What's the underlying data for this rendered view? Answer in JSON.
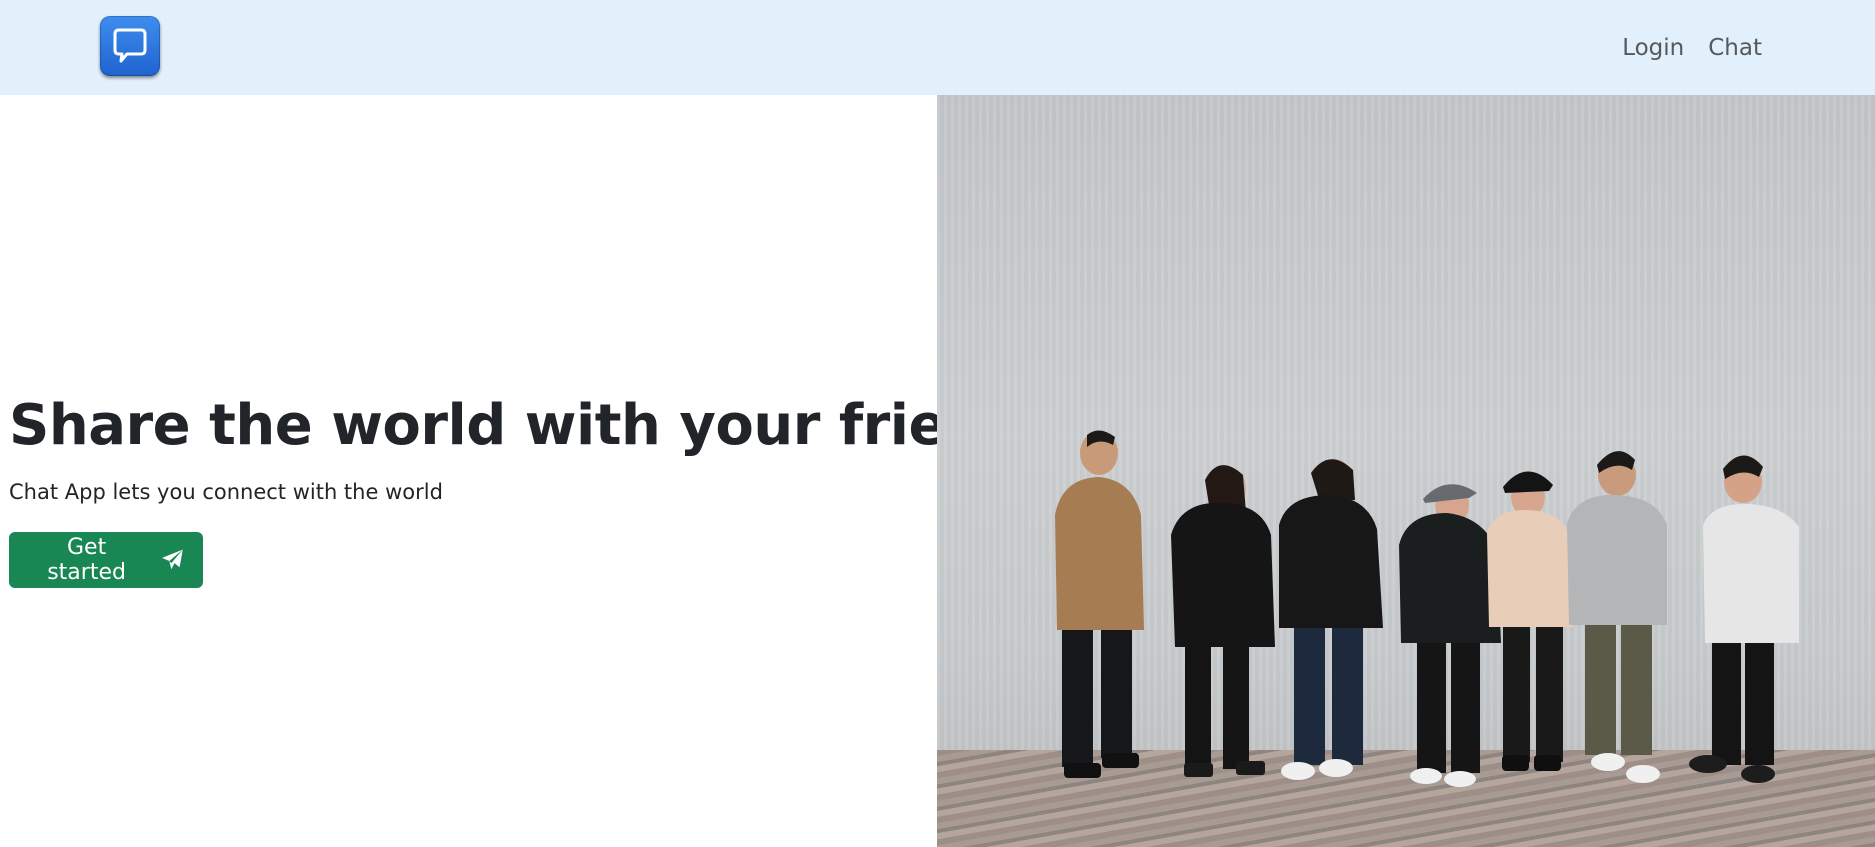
{
  "navbar": {
    "logo_icon": "chat-bubble-icon",
    "links": [
      "Login",
      "Chat"
    ]
  },
  "hero": {
    "title": "Share the world with your friends",
    "subtitle": "Chat App lets you connect with the world",
    "cta_label": "Get started",
    "cta_icon": "paper-plane-icon",
    "image_icon": "photo-of-group-of-friends"
  },
  "colors": {
    "navbar_bg": "#e2f0fc",
    "cta_bg": "#198754",
    "logo_blue": "#2f78e0",
    "text": "#212529"
  }
}
